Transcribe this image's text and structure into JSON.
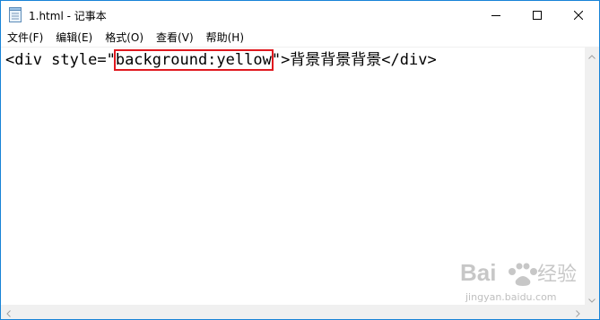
{
  "window": {
    "title": "1.html - 记事本"
  },
  "menu": [
    {
      "label": "文件(F)"
    },
    {
      "label": "编辑(E)"
    },
    {
      "label": "格式(O)"
    },
    {
      "label": "查看(V)"
    },
    {
      "label": "帮助(H)"
    }
  ],
  "editor": {
    "before": "<div style=\"",
    "highlighted": "background:yellow",
    "after": "\">背景背景背景</div>"
  },
  "watermark": {
    "text": "jingyan.baidu.com"
  },
  "colors": {
    "window_border": "#1883d7",
    "highlight_box": "#e0191f",
    "scrollbar_bg": "#f0f0f0"
  },
  "icons": {
    "app": "notepad-icon",
    "minimize": "minimize-icon",
    "maximize": "maximize-icon",
    "close": "close-icon"
  }
}
